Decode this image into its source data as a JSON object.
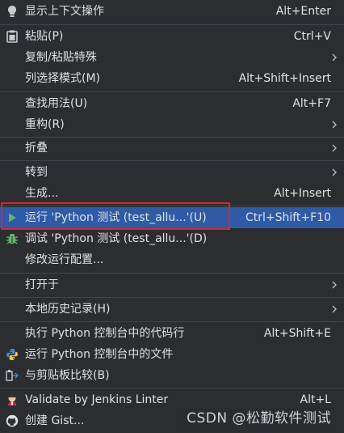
{
  "menu": {
    "items": [
      {
        "label": "显示上下文操作",
        "shortcut": "Alt+Enter",
        "icon": "lightbulb-icon"
      },
      {
        "label": "粘贴(P)",
        "shortcut": "Ctrl+V",
        "icon": "clipboard-icon"
      },
      {
        "label": "复制/粘贴特殊",
        "shortcut": "",
        "icon": ""
      },
      {
        "label": "列选择模式(M)",
        "shortcut": "Alt+Shift+Insert",
        "icon": ""
      },
      {
        "label": "查找用法(U)",
        "shortcut": "Alt+F7",
        "icon": ""
      },
      {
        "label": "重构(R)",
        "shortcut": "",
        "icon": ""
      },
      {
        "label": "折叠",
        "shortcut": "",
        "icon": ""
      },
      {
        "label": "转到",
        "shortcut": "",
        "icon": ""
      },
      {
        "label": "生成...",
        "shortcut": "Alt+Insert",
        "icon": ""
      },
      {
        "label": "运行 'Python 测试 (test_allu...'(U)",
        "shortcut": "Ctrl+Shift+F10",
        "icon": "run-play-icon"
      },
      {
        "label": "调试 'Python 测试 (test_allu...'(D)",
        "shortcut": "",
        "icon": "debug-bug-icon"
      },
      {
        "label": "修改运行配置...",
        "shortcut": "",
        "icon": ""
      },
      {
        "label": "打开于",
        "shortcut": "",
        "icon": ""
      },
      {
        "label": "本地历史记录(H)",
        "shortcut": "",
        "icon": ""
      },
      {
        "label": "执行 Python 控制台中的代码行",
        "shortcut": "Alt+Shift+E",
        "icon": ""
      },
      {
        "label": "运行 Python 控制台中的文件",
        "shortcut": "",
        "icon": "python-icon"
      },
      {
        "label": "与剪贴板比较(B)",
        "shortcut": "",
        "icon": "compare-icon"
      },
      {
        "label": "Validate by Jenkins Linter",
        "shortcut": "Alt+L",
        "icon": "jenkins-icon"
      },
      {
        "label": "创建 Gist...",
        "shortcut": "",
        "icon": "github-icon"
      }
    ]
  },
  "watermark": "CSDN @松勤软件测试",
  "colors": {
    "background": "#2b2d30",
    "selection": "#2e5aa8",
    "highlight_border": "#e0232d",
    "text": "#dfe1e5"
  }
}
